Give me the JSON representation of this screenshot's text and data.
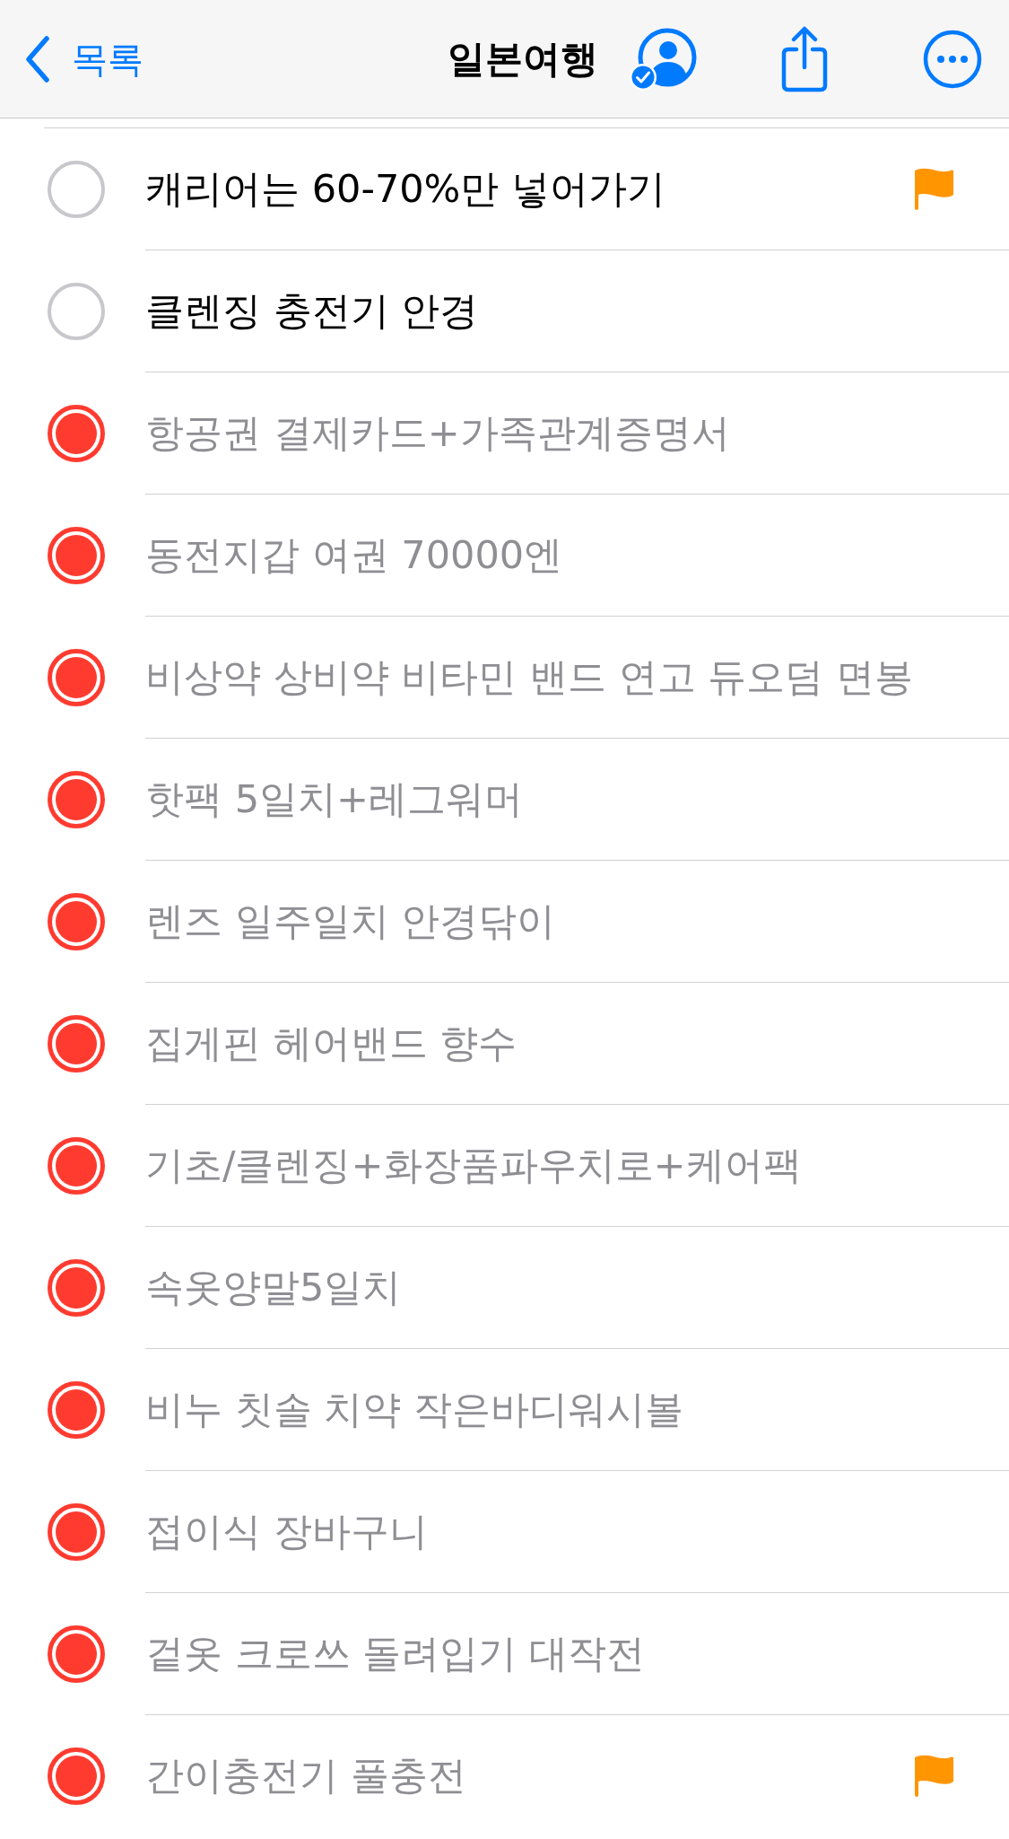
{
  "nav": {
    "back_label": "목록",
    "title": "일본여행"
  },
  "items": [
    {
      "text": "캐리어는 60-70%만 넣어가기",
      "completed": false,
      "flagged": true
    },
    {
      "text": "클렌징 충전기 안경",
      "completed": false,
      "flagged": false
    },
    {
      "text": "항공권 결제카드+가족관계증명서",
      "completed": true,
      "flagged": false
    },
    {
      "text": "동전지갑 여권 70000엔",
      "completed": true,
      "flagged": false
    },
    {
      "text": "비상약 상비약 비타민 밴드 연고 듀오덤 면봉",
      "completed": true,
      "flagged": false
    },
    {
      "text": "핫팩 5일치+레그워머",
      "completed": true,
      "flagged": false
    },
    {
      "text": "렌즈 일주일치 안경닦이",
      "completed": true,
      "flagged": false
    },
    {
      "text": "집게핀 헤어밴드 향수",
      "completed": true,
      "flagged": false
    },
    {
      "text": "기초/클렌징+화장품파우치로+케어팩",
      "completed": true,
      "flagged": false
    },
    {
      "text": "속옷양말5일치",
      "completed": true,
      "flagged": false
    },
    {
      "text": "비누 칫솔 치약 작은바디워시볼",
      "completed": true,
      "flagged": false
    },
    {
      "text": "접이식 장바구니",
      "completed": true,
      "flagged": false
    },
    {
      "text": "겉옷 크로쓰 돌려입기 대작전",
      "completed": true,
      "flagged": false
    },
    {
      "text": "간이충전기 풀충전",
      "completed": true,
      "flagged": true
    }
  ]
}
